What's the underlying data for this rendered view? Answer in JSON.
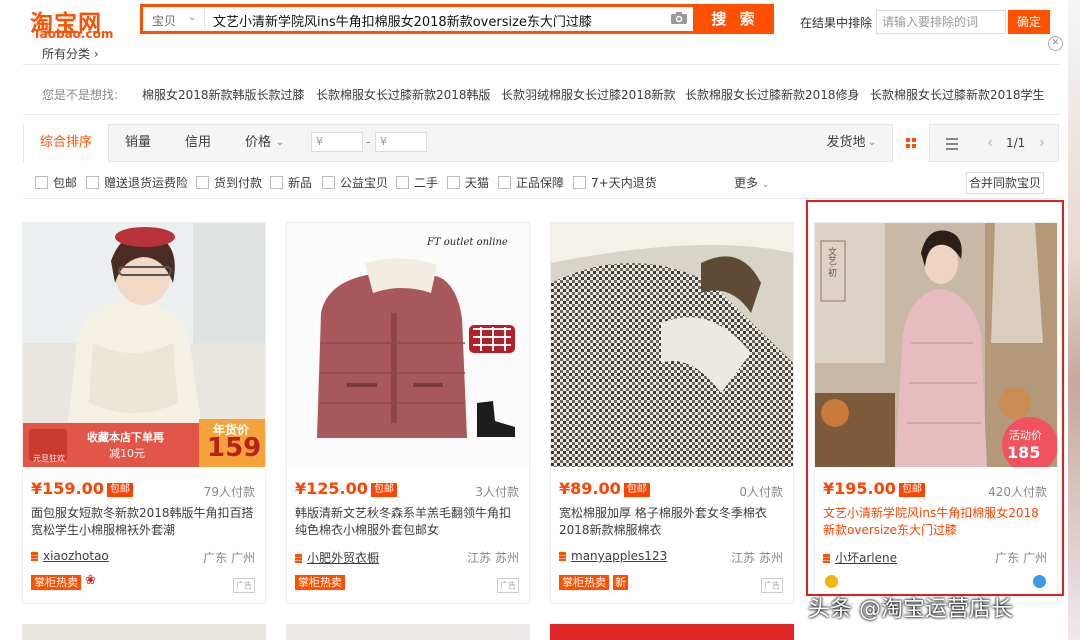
{
  "header": {
    "logo_main": "淘宝网",
    "logo_sub": "Taobao.com",
    "search_scope": "宝贝",
    "search_query": "文艺小清新学院风ins牛角扣棉服女2018新款oversize东大门过膝",
    "search_button": "搜 索",
    "exclude_label": "在结果中排除",
    "exclude_placeholder": "请输入要排除的词",
    "exclude_confirm": "确定",
    "all_categories": "所有分类 ›"
  },
  "suggestions": {
    "label": "您是不是想找:",
    "items": [
      "棉服女2018新款韩版长款过膝",
      "长款棉服女长过膝新款2018韩版",
      "长款羽绒棉服女长过膝2018新款",
      "长款棉服女长过膝新款2018修身",
      "长款棉服女长过膝新款2018学生"
    ]
  },
  "sortbar": {
    "tabs": [
      "综合排序",
      "销量",
      "信用",
      "价格"
    ],
    "price_from": "¥",
    "price_to": "¥",
    "dash": "-",
    "ship_from": "发货地",
    "page": "1/1"
  },
  "filters": {
    "items": [
      "包邮",
      "赠送退货运费险",
      "货到付款",
      "新品",
      "公益宝贝",
      "二手",
      "天猫",
      "正品保障",
      "7+天内退货"
    ],
    "more": "更多",
    "merge": "合并同款宝贝"
  },
  "products": [
    {
      "price": "¥159.00",
      "baoyou": "包邮",
      "sales": "79人付款",
      "title": "面包服女短款冬新款2018韩版牛角扣百搭宽松学生小棉服棉袄外套潮",
      "shop": "xiaozhotao",
      "location": "广东 广州",
      "tags": [
        "掌柜热卖"
      ],
      "promo_line1": "收藏本店下单再",
      "promo_line2": "减10元",
      "promo_badge_top": "年货价",
      "promo_badge_price": "159",
      "promo_badge_small": "元旦狂欢"
    },
    {
      "price": "¥125.00",
      "baoyou": "包邮",
      "sales": "3人付款",
      "title": "韩版清新文艺秋冬森系羊羔毛翻领牛角扣纯色棉衣小棉服外套包邮女",
      "shop": "小肥外贸衣橱",
      "location": "江苏 苏州",
      "tags": [
        "掌柜热卖"
      ],
      "image_caption": "FT outlet online"
    },
    {
      "price": "¥89.00",
      "baoyou": "包邮",
      "sales": "0人付款",
      "title": "宽松棉服加厚 格子棉服外套女冬季棉衣2018新款棉服棉衣",
      "shop": "manyapples123",
      "location": "江苏 苏州",
      "tags": [
        "掌柜热卖",
        "新"
      ]
    },
    {
      "price": "¥195.00",
      "baoyou": "包邮",
      "sales": "420人付款",
      "title": "文艺小清新学院风ins牛角扣棉服女2018新款oversize东大门过膝",
      "shop": "小坏arlene",
      "location": "广东 广州",
      "tags": [],
      "promo_badge_top": "活动价",
      "promo_badge_price": "185",
      "image_caption": "文艺·初"
    }
  ],
  "watermark": "头条 @淘宝运营店长",
  "colors": {
    "brand": "#ff5000",
    "price": "#ff4400",
    "highlight_box": "#e02020"
  }
}
